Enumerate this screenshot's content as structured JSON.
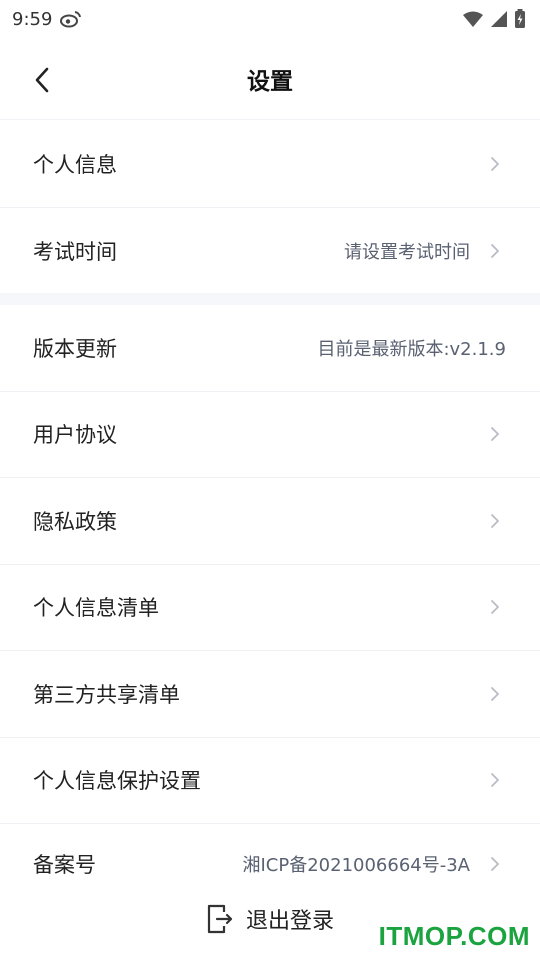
{
  "status_bar": {
    "time": "9:59",
    "app_icon": "weibo-icon",
    "icons": [
      "wifi-icon",
      "cellular-signal-icon",
      "battery-charging-icon"
    ]
  },
  "nav": {
    "back_icon": "chevron-left-icon",
    "title": "设置"
  },
  "section1": {
    "items": [
      {
        "label": "个人信息",
        "value": "",
        "chevron": true
      },
      {
        "label": "考试时间",
        "value": "请设置考试时间",
        "chevron": true
      }
    ]
  },
  "section2": {
    "items": [
      {
        "label": "版本更新",
        "value": "目前是最新版本:v2.1.9",
        "chevron": false
      },
      {
        "label": "用户协议",
        "value": "",
        "chevron": true
      },
      {
        "label": "隐私政策",
        "value": "",
        "chevron": true
      },
      {
        "label": "个人信息清单",
        "value": "",
        "chevron": true
      },
      {
        "label": "第三方共享清单",
        "value": "",
        "chevron": true
      },
      {
        "label": "个人信息保护设置",
        "value": "",
        "chevron": true
      },
      {
        "label": "备案号",
        "value": "湘ICP备2021006664号-3A",
        "chevron": true
      }
    ]
  },
  "logout": {
    "icon": "logout-icon",
    "label": "退出登录"
  },
  "watermark": "ITMOP.COM",
  "colors": {
    "separator": "#eef0f3",
    "section_gap": "#f5f7fa",
    "value_text": "#5a6272",
    "watermark": "#1aa33f"
  }
}
